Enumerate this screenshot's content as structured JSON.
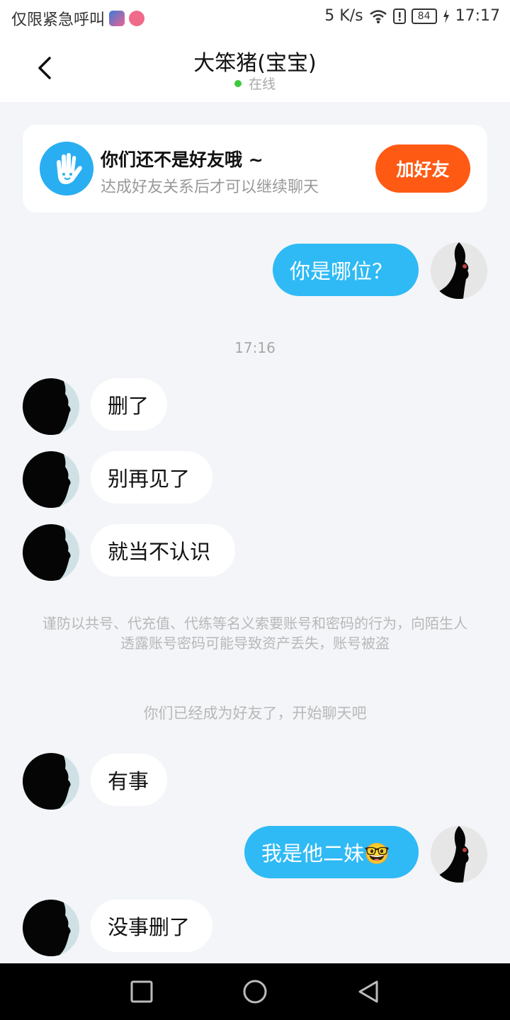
{
  "status_bar": {
    "carrier": "仅限紧急呼叫",
    "speed": "5 K/s",
    "battery": "84",
    "time": "17:17"
  },
  "header": {
    "title": "大笨猪(宝宝)",
    "status": "在线"
  },
  "friend_card": {
    "title": "你们还不是好友哦 ~",
    "subtitle": "达成好友关系后才可以继续聊天",
    "button": "加好友"
  },
  "messages": [
    {
      "from": "me",
      "text": "你是哪位？"
    },
    {
      "type": "time",
      "text": "17:16"
    },
    {
      "from": "other",
      "text": "删了"
    },
    {
      "from": "other",
      "text": "别再见了"
    },
    {
      "from": "other",
      "text": "就当不认识"
    },
    {
      "type": "notice",
      "text": "谨防以共号、代充值、代练等名义索要账号和密码的行为，向陌生人透露账号密码可能导致资产丢失，账号被盗"
    },
    {
      "type": "system",
      "text": "你们已经成为好友了，开始聊天吧"
    },
    {
      "from": "other",
      "text": "有事"
    },
    {
      "from": "me",
      "text": "我是他二妹🤓"
    },
    {
      "from": "other",
      "text": "没事删了"
    }
  ],
  "colors": {
    "accent": "#2fbaf5",
    "add_button": "#ff5a14",
    "background": "#f3f5f8",
    "online_dot": "#3cc93c"
  },
  "icons": [
    "wifi-icon",
    "alert-icon",
    "battery-icon",
    "charging-icon",
    "back-arrow-icon",
    "hand-wave-icon",
    "nav-recents-icon",
    "nav-home-icon",
    "nav-back-icon"
  ]
}
